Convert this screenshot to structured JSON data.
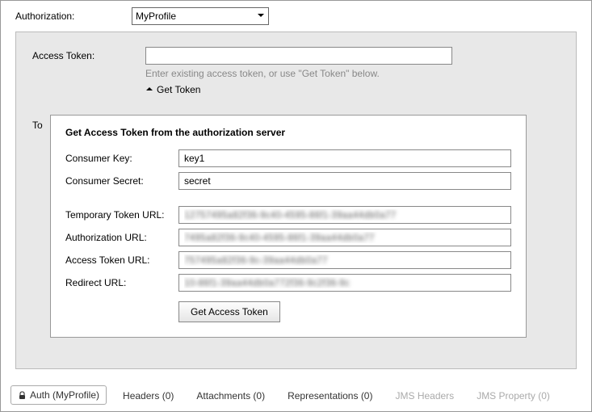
{
  "header": {
    "authorization_label": "Authorization:",
    "profile_selected": "MyProfile"
  },
  "main": {
    "access_token_label": "Access Token:",
    "access_token_value": "",
    "access_token_hint": "Enter existing access token, or use \"Get Token\" below.",
    "get_token_toggle": "Get Token",
    "token_peek_label": "To"
  },
  "popup": {
    "title": "Get Access Token from the authorization server",
    "consumer_key_label": "Consumer Key:",
    "consumer_key_value": "key1",
    "consumer_secret_label": "Consumer Secret:",
    "consumer_secret_value": "secret",
    "temp_token_url_label": "Temporary Token URL:",
    "temp_token_url_value": "12757495a82f36-9c40-4595-86f1-39aa44db0a77",
    "auth_url_label": "Authorization URL:",
    "auth_url_value": "7495a82f36-9c40-4595-86f1-39aa44db0a77",
    "access_token_url_label": "Access Token URL:",
    "access_token_url_value": "757495a82f36-9c-39aa44db0a77",
    "redirect_url_label": "Redirect URL:",
    "redirect_url_value": "10-86f1-39aa44db0a772f36-9c2f36-9c",
    "get_button": "Get Access Token"
  },
  "tabs": {
    "auth": "Auth (MyProfile)",
    "headers": "Headers (0)",
    "attachments": "Attachments (0)",
    "representations": "Representations (0)",
    "jms_headers": "JMS Headers",
    "jms_property": "JMS Property (0)"
  }
}
